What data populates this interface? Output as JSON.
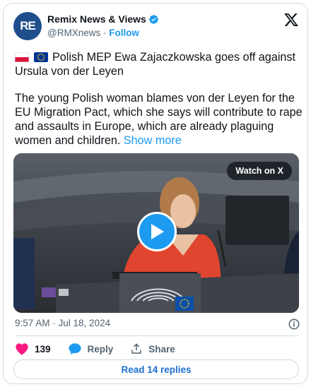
{
  "account": {
    "avatar_text": "RE",
    "display_name": "Remix News & Views",
    "handle": "@RMXnews",
    "separator": "·",
    "follow_label": "Follow"
  },
  "tweet": {
    "headline": "Polish MEP Ewa Zajaczkowska goes off against Ursula von der Leyen",
    "body": "The young Polish woman blames von der Leyen for the EU Migration Pact, which she says will contribute to rape and assaults in Europe, which are already plaguing women and children.",
    "show_more": "Show more",
    "flags": [
      "poland-flag-icon",
      "eu-flag-icon"
    ]
  },
  "media": {
    "watch_label": "Watch on X"
  },
  "meta": {
    "timestamp": "9:57 AM · Jul 18, 2024"
  },
  "actions": {
    "likes": "139",
    "reply_label": "Reply",
    "share_label": "Share"
  },
  "replies_button": "Read 14 replies",
  "colors": {
    "accent": "#1d9bf0",
    "like": "#f91880",
    "avatar": "#1f4e8c",
    "text": "#0f1419",
    "muted": "#536471"
  }
}
